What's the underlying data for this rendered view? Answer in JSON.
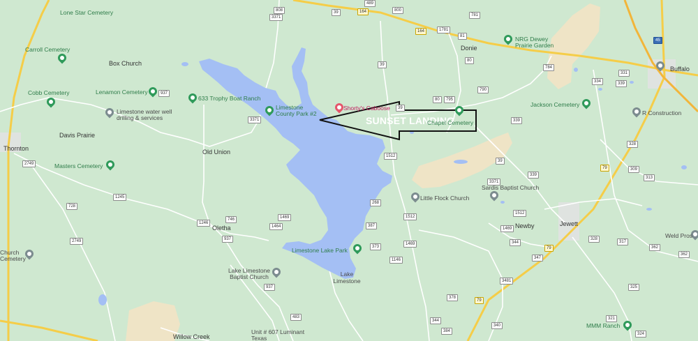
{
  "annotation": {
    "text": "SUNSET LANDING"
  },
  "places": [
    {
      "name": "Lone Star Cemetery",
      "type": "cemetery"
    },
    {
      "name": "Carroll Cemetery",
      "type": "cemetery"
    },
    {
      "name": "Box Church",
      "type": "town"
    },
    {
      "name": "Cobb Cemetery",
      "type": "cemetery"
    },
    {
      "name": "Lenamon Cemetery",
      "type": "cemetery"
    },
    {
      "name": "633 Trophy Boat Ranch",
      "type": "poi"
    },
    {
      "name": "Limestone water well drilling & services",
      "type": "business"
    },
    {
      "name": "Davis Prairie",
      "type": "town"
    },
    {
      "name": "Thornton",
      "type": "town"
    },
    {
      "name": "Masters Cemetery",
      "type": "cemetery"
    },
    {
      "name": "Old Union",
      "type": "town"
    },
    {
      "name": "Limestone County Park #2",
      "type": "park"
    },
    {
      "name": "Shorty's Caboose",
      "type": "restaurant"
    },
    {
      "name": "Chapel Cemetery",
      "type": "cemetery"
    },
    {
      "name": "Donie",
      "type": "town"
    },
    {
      "name": "NRG Dewey Prairie Garden",
      "type": "poi"
    },
    {
      "name": "Buffalo",
      "type": "town"
    },
    {
      "name": "Jackson Cemetery",
      "type": "cemetery"
    },
    {
      "name": "R Construction",
      "type": "business"
    },
    {
      "name": "Sardis Baptist Church",
      "type": "church"
    },
    {
      "name": "Little Flock Church",
      "type": "church"
    },
    {
      "name": "Newby",
      "type": "town"
    },
    {
      "name": "Jewett",
      "type": "town"
    },
    {
      "name": "Weld Pros",
      "type": "business"
    },
    {
      "name": "Oletha",
      "type": "town"
    },
    {
      "name": "Limestone Lake Park",
      "type": "park"
    },
    {
      "name": "Lake Limestone",
      "type": "water"
    },
    {
      "name": "Lake Limestone Baptist Church",
      "type": "church"
    },
    {
      "name": "Church Cemetery",
      "type": "cemetery"
    },
    {
      "name": "Willow Creek",
      "type": "town"
    },
    {
      "name": "Unit # 607 Luminant Texas",
      "type": "business"
    },
    {
      "name": "MMM Ranch",
      "type": "poi"
    }
  ],
  "road_shields": [
    "808",
    "3371",
    "489",
    "800",
    "39",
    "164",
    "781",
    "81",
    "164",
    "39",
    "1781",
    "80",
    "784",
    "937",
    "3371",
    "80",
    "795",
    "790",
    "339",
    "334",
    "339",
    "331",
    "328",
    "79",
    "39",
    "1512",
    "268",
    "39",
    "1512",
    "339",
    "3371",
    "313",
    "309",
    "1245",
    "2749",
    "728",
    "1246",
    "746",
    "1469",
    "1464",
    "1512",
    "1469",
    "1469",
    "344",
    "79",
    "387",
    "373",
    "1146",
    "347",
    "328",
    "2749",
    "937",
    "3481",
    "317",
    "362",
    "362",
    "79",
    "325",
    "483",
    "378",
    "344",
    "384",
    "340",
    "321",
    "324",
    "937"
  ],
  "colors": {
    "land": "#cfe8d0",
    "water": "#a4bff4",
    "road_major": "#f5cd48",
    "road_minor": "#ffffff",
    "sand": "#efe4c6"
  }
}
